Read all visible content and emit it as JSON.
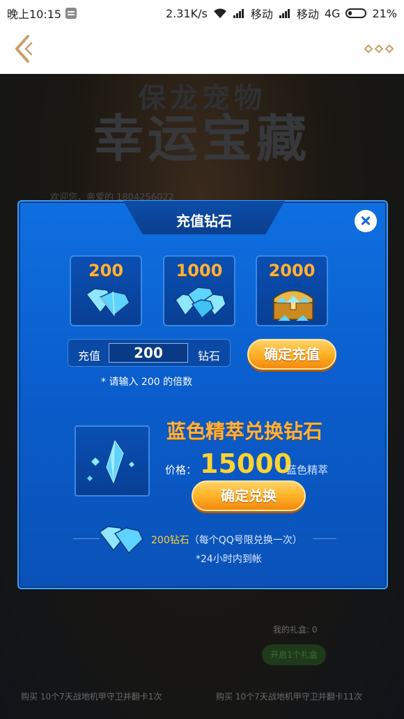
{
  "status_bar": {
    "time": "晚上10:15",
    "speed": "2.31K/s",
    "carrier1": "移动",
    "carrier2": "移动",
    "network": "4G",
    "battery": "21%"
  },
  "nav": {
    "back_icon": "chevron-left-icon",
    "more_icon": "more-dots-icon",
    "accent": "#c8a06a"
  },
  "background": {
    "title_line1": "保龙宠物",
    "title_line2": "幸运宝藏",
    "welcome": "欢迎您，亲爱的 1804256022",
    "gift_count": "我的礼盒: 0",
    "open_button": "开启1个礼盒",
    "buy1": "购买      10个7天战地机甲守卫并翻卡1次",
    "buy2": "购买      10个7天战地机甲守卫并翻卡11次"
  },
  "modal": {
    "title": "充值钻石",
    "close_icon": "close-icon",
    "options": [
      {
        "amount": "200",
        "icon": "diamond-small-icon"
      },
      {
        "amount": "1000",
        "icon": "diamond-pile-icon"
      },
      {
        "amount": "2000",
        "icon": "treasure-chest-icon"
      }
    ],
    "recharge": {
      "label": "充值",
      "value": "200",
      "unit": "钻石",
      "confirm": "确定充值",
      "hint": "* 请输入 200 的倍数"
    },
    "exchange": {
      "title": "蓝色精萃兑换钻石",
      "price_label": "价格：",
      "price": "15000",
      "price_unit": "蓝色精萃",
      "confirm": "确定兑换",
      "crystal_icon": "blue-crystal-icon"
    },
    "footer": {
      "highlight": "200钻石",
      "rest": "（每个QQ号限兑换一次）",
      "note": "*24小时内到帐"
    }
  },
  "colors": {
    "modal_blue": "#0f6fe0",
    "gold": "#ffb23e",
    "button_orange": "#f3890f"
  }
}
